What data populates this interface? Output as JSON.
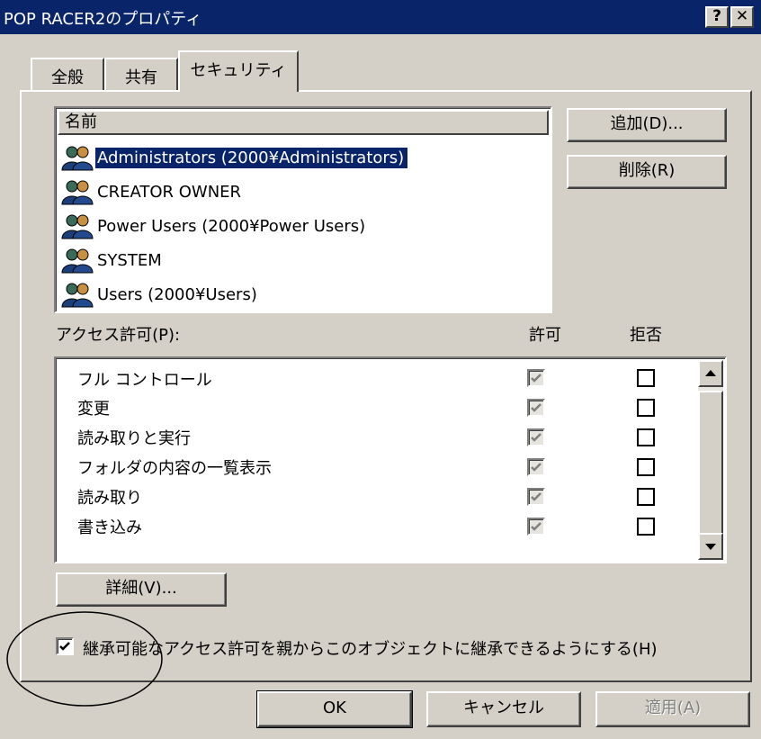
{
  "window": {
    "title": "POP RACER2のプロパティ",
    "help_label": "?",
    "close_label": "✕"
  },
  "tabs": [
    {
      "label": "全般",
      "active": false
    },
    {
      "label": "共有",
      "active": false
    },
    {
      "label": "セキュリティ",
      "active": true
    }
  ],
  "users": {
    "header": "名前",
    "items": [
      {
        "label": "Administrators (2000¥Administrators)",
        "selected": true
      },
      {
        "label": "CREATOR OWNER",
        "selected": false
      },
      {
        "label": "Power Users (2000¥Power Users)",
        "selected": false
      },
      {
        "label": "SYSTEM",
        "selected": false
      },
      {
        "label": "Users (2000¥Users)",
        "selected": false
      }
    ],
    "add_button": "追加(D)...",
    "remove_button": "削除(R)"
  },
  "permissions": {
    "label": "アクセス許可(P):",
    "allow_header": "許可",
    "deny_header": "拒否",
    "items": [
      {
        "label": "フル コントロール",
        "allow": true,
        "deny": false
      },
      {
        "label": "変更",
        "allow": true,
        "deny": false
      },
      {
        "label": "読み取りと実行",
        "allow": true,
        "deny": false
      },
      {
        "label": "フォルダの内容の一覧表示",
        "allow": true,
        "deny": false
      },
      {
        "label": "読み取り",
        "allow": true,
        "deny": false
      },
      {
        "label": "書き込み",
        "allow": true,
        "deny": false
      }
    ],
    "advanced_button": "詳細(V)..."
  },
  "inherit": {
    "label": "継承可能なアクセス許可を親からこのオブジェクトに継承できるようにする(H)",
    "checked": true
  },
  "footer": {
    "ok": "OK",
    "cancel": "キャンセル",
    "apply": "適用(A)"
  },
  "colors": {
    "title_bar": "#0a246a",
    "face": "#d4d0c8",
    "selection": "#0a246a",
    "grey_check": "#808080"
  }
}
